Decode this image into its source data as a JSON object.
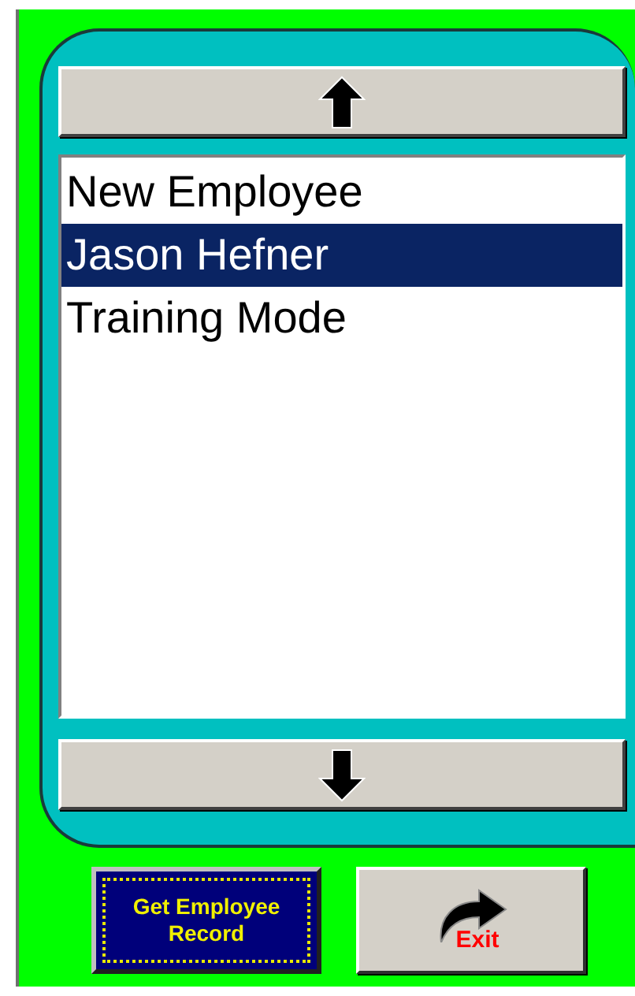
{
  "employees": [
    {
      "name": "New Employee",
      "selected": false
    },
    {
      "name": "Jason Hefner",
      "selected": true
    },
    {
      "name": "Training Mode",
      "selected": false
    }
  ],
  "buttons": [
    {
      "kind": "record",
      "label": "Get Employee Record"
    },
    {
      "kind": "exit",
      "label": "Exit"
    }
  ]
}
